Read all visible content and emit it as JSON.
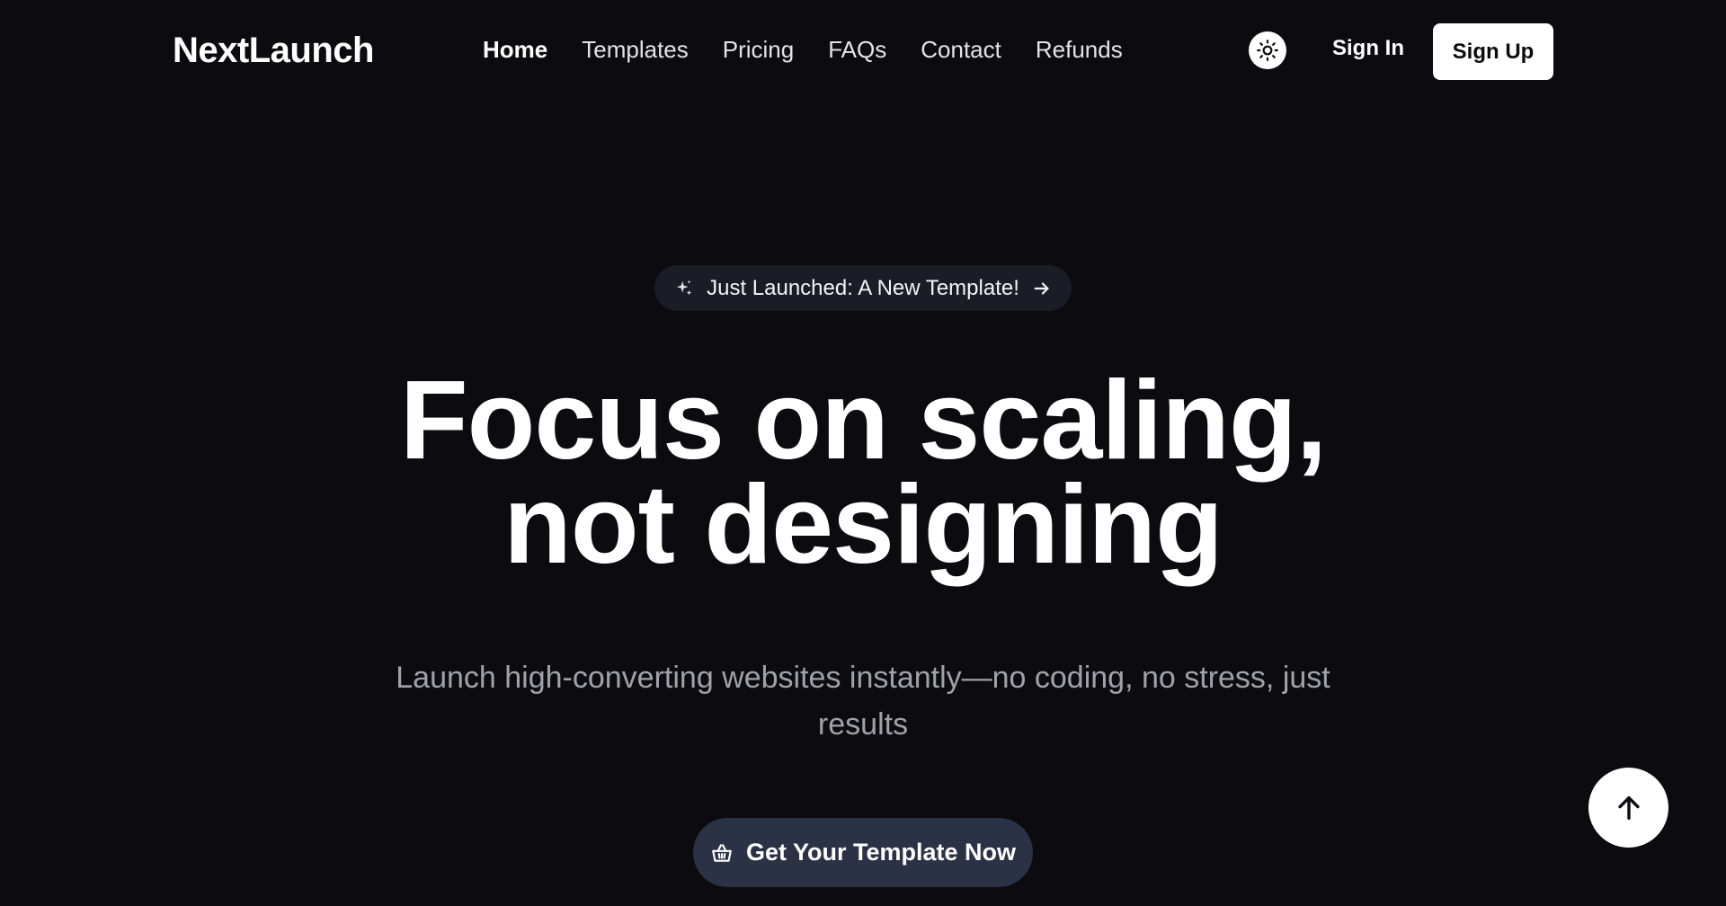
{
  "brand": {
    "name": "NextLaunch"
  },
  "nav": {
    "items": [
      {
        "label": "Home",
        "active": true
      },
      {
        "label": "Templates",
        "active": false
      },
      {
        "label": "Pricing",
        "active": false
      },
      {
        "label": "FAQs",
        "active": false
      },
      {
        "label": "Contact",
        "active": false
      },
      {
        "label": "Refunds",
        "active": false
      }
    ]
  },
  "header_actions": {
    "theme_icon": "sun-icon",
    "sign_in": "Sign In",
    "sign_up": "Sign Up"
  },
  "hero": {
    "announcement": {
      "icon": "sparkle-icon",
      "text": "Just Launched: A New Template!",
      "arrow_icon": "arrow-right-icon"
    },
    "headline_line1": "Focus on scaling,",
    "headline_line2": "not designing",
    "subtitle": "Launch high-converting websites instantly—no coding, no stress, just results",
    "cta": {
      "icon": "basket-icon",
      "label": "Get Your Template Now"
    }
  },
  "scroll_top": {
    "icon": "arrow-up-icon"
  },
  "colors": {
    "background": "#0c0c10",
    "text_primary": "#ffffff",
    "text_muted": "#a1a1aa",
    "pill_bg": "#1a1d26",
    "cta_bg": "#2b3245"
  }
}
